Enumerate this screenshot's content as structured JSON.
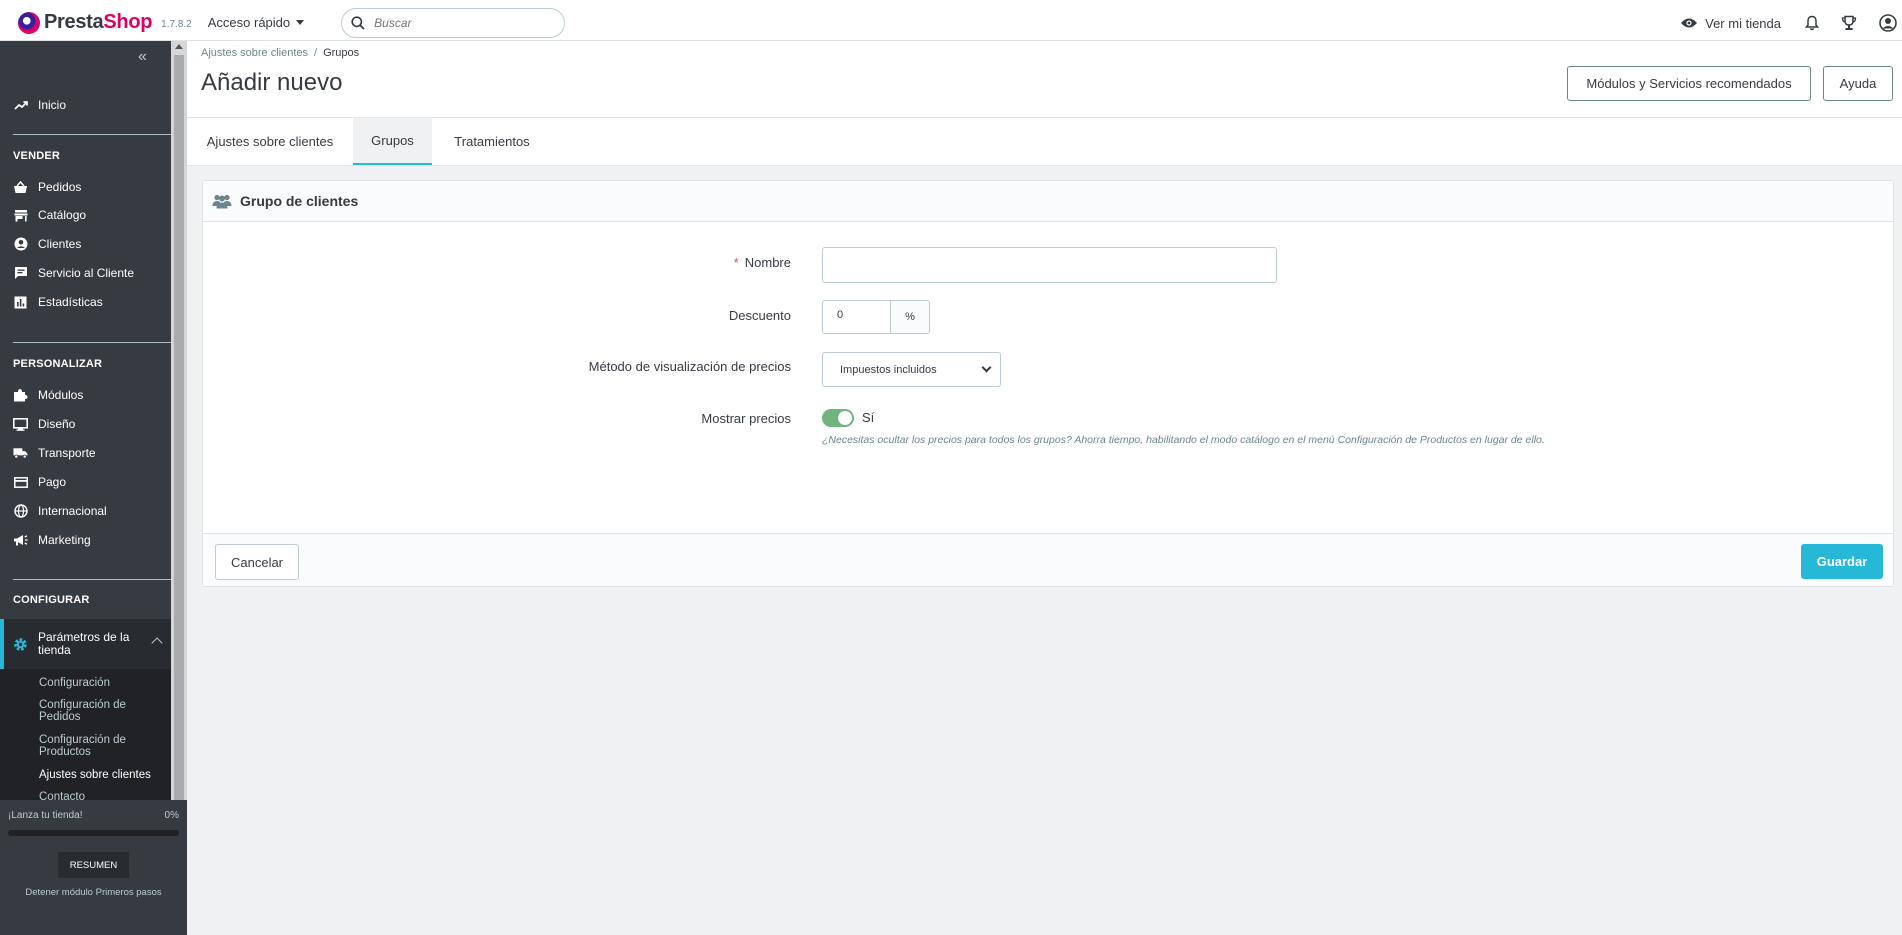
{
  "header": {
    "brand_presta": "Presta",
    "brand_shop": "Shop",
    "version": "1.7.8.2",
    "quick_access": "Acceso rápido",
    "search_placeholder": "Buscar",
    "view_store": "Ver mi tienda",
    "icons": [
      "eye-icon",
      "bell-icon",
      "trophy-icon",
      "user-icon"
    ]
  },
  "sidebar": {
    "home": "Inicio",
    "sections": [
      {
        "title": "VENDER",
        "items": [
          "Pedidos",
          "Catálogo",
          "Clientes",
          "Servicio al Cliente",
          "Estadísticas"
        ]
      },
      {
        "title": "PERSONALIZAR",
        "items": [
          "Módulos",
          "Diseño",
          "Transporte",
          "Pago",
          "Internacional",
          "Marketing"
        ]
      },
      {
        "title": "CONFIGURAR"
      }
    ],
    "active": "Parámetros de la tienda",
    "sub_items": [
      "Configuración",
      "Configuración de Pedidos",
      "Configuración de Productos",
      "Ajustes sobre clientes",
      "Contacto"
    ],
    "current_sub": "Ajustes sobre clientes"
  },
  "launch": {
    "label": "¡Lanza tu tienda!",
    "percent": "0%",
    "progress": 0,
    "summary_button": "RESUMEN",
    "stop_link": "Detener módulo Primeros pasos"
  },
  "page": {
    "breadcrumb": [
      "Ajustes sobre clientes",
      "Grupos"
    ],
    "title": "Añadir nuevo",
    "btn_modules": "Módulos y Servicios recomendados",
    "btn_help": "Ayuda",
    "tabs": [
      "Ajustes sobre clientes",
      "Grupos",
      "Tratamientos"
    ],
    "active_tab": "Grupos"
  },
  "form": {
    "panel_title": "Grupo de clientes",
    "required_mark": "*",
    "name_label": "Nombre",
    "name_value": "",
    "discount_label": "Descuento",
    "discount_value": "0",
    "discount_unit": "%",
    "price_method_label": "Método de visualización de precios",
    "price_method_value": "Impuestos incluidos",
    "show_prices_label": "Mostrar precios",
    "show_prices_value": "Sí",
    "help_text": "¿Necesitas ocultar los precios para todos los grupos? Ahorra tiempo, habilitando el modo catálogo en el menú Configuración de Productos en lugar de ello.",
    "cancel": "Cancelar",
    "save": "Guardar"
  },
  "colors": {
    "accent": "#25b9d7",
    "brand_pink": "#df0067",
    "sidebar_bg": "#363a41",
    "switch_on": "#70b580"
  }
}
